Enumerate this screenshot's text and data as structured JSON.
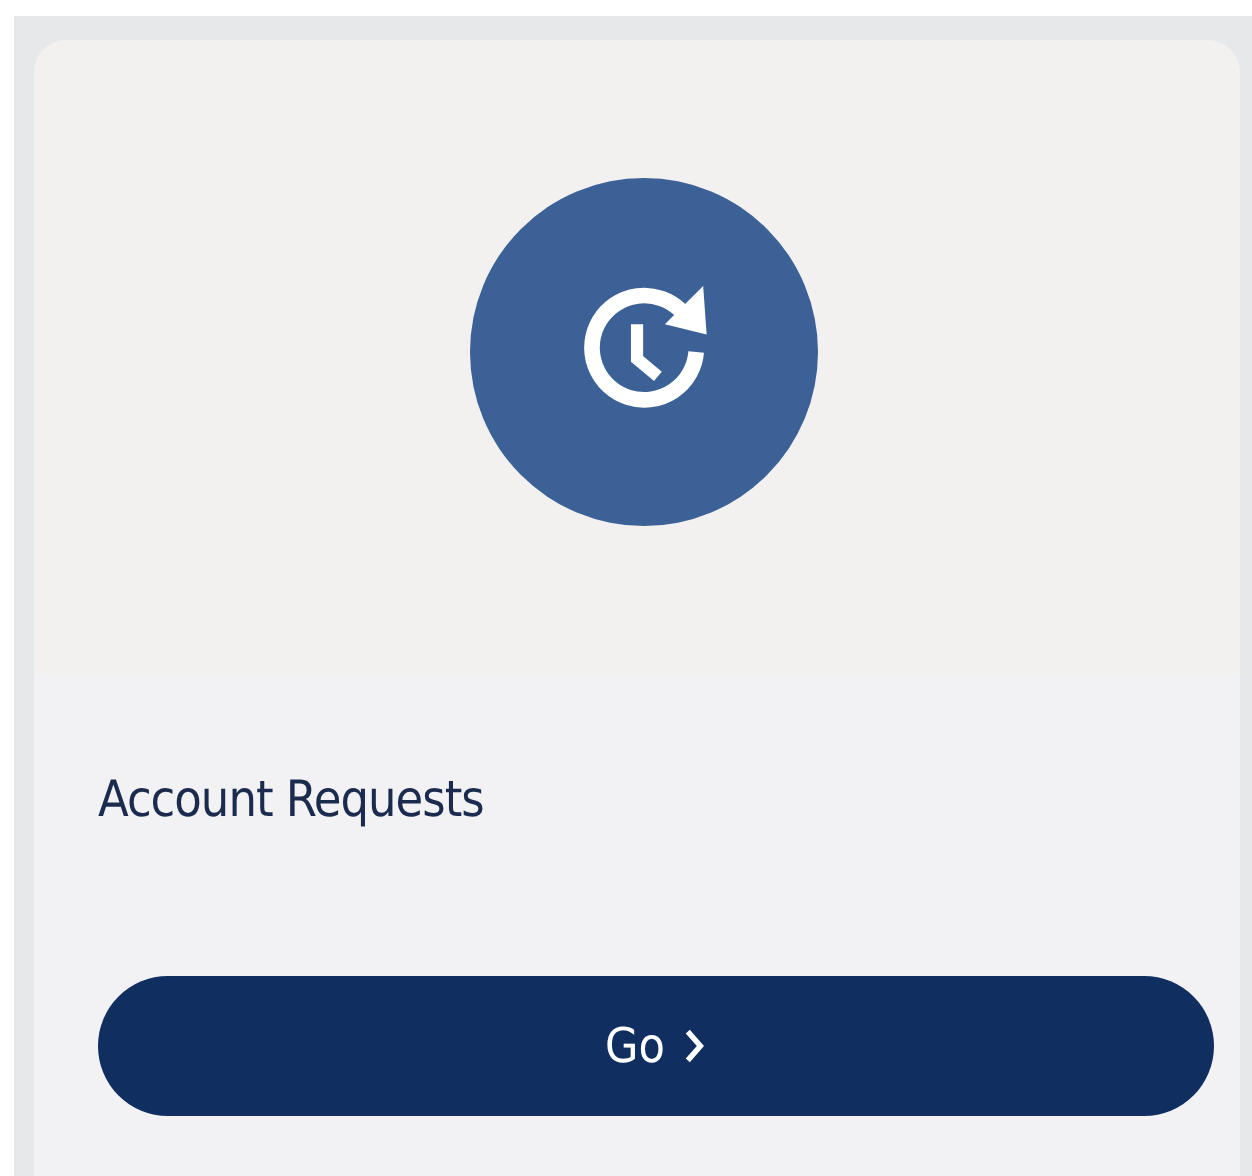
{
  "card": {
    "title": "Account Requests",
    "button": {
      "label": "Go"
    }
  }
}
